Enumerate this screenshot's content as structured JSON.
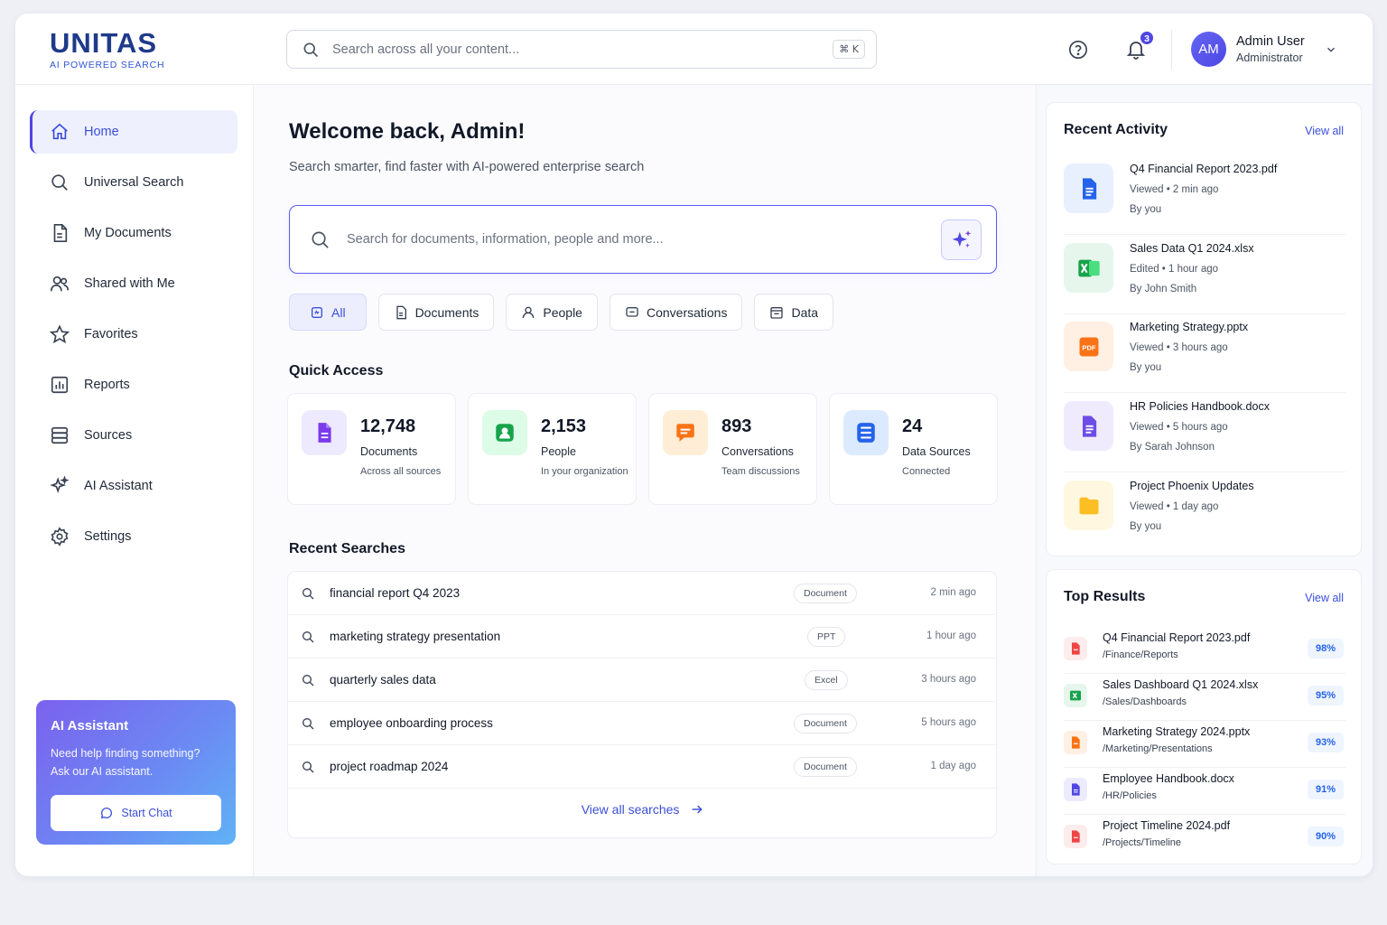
{
  "brand": {
    "name": "UNITAS",
    "tagline": "AI POWERED SEARCH"
  },
  "topbar": {
    "search_placeholder": "Search across all your content...",
    "shortcut": "⌘ K",
    "notification_count": "3",
    "user": {
      "initials": "AM",
      "name": "Admin User",
      "role": "Administrator"
    }
  },
  "sidebar": {
    "items": [
      {
        "label": "Home",
        "icon": "home-icon",
        "active": true
      },
      {
        "label": "Universal Search",
        "icon": "search-icon"
      },
      {
        "label": "My Documents",
        "icon": "document-icon"
      },
      {
        "label": "Shared with Me",
        "icon": "users-icon"
      },
      {
        "label": "Favorites",
        "icon": "star-icon"
      },
      {
        "label": "Reports",
        "icon": "bar-chart-icon"
      },
      {
        "label": "Sources",
        "icon": "database-icon"
      },
      {
        "label": "AI Assistant",
        "icon": "sparkle-icon"
      },
      {
        "label": "Settings",
        "icon": "gear-icon"
      }
    ],
    "ai_card": {
      "title": "AI Assistant",
      "description": "Need help finding something? Ask our AI assistant.",
      "button": "Start Chat"
    }
  },
  "main": {
    "welcome": "Welcome back, Admin!",
    "subtitle": "Search smarter, find faster with AI-powered enterprise search",
    "search_placeholder": "Search for documents, information, people and more...",
    "filters": [
      "All",
      "Documents",
      "People",
      "Conversations",
      "Data"
    ],
    "quick_access_title": "Quick Access",
    "quick_access": [
      {
        "value": "12,748",
        "label": "Documents",
        "sub": "Across all sources",
        "color": "#7c3aed"
      },
      {
        "value": "2,153",
        "label": "People",
        "sub": "In your organization",
        "color": "#16a34a"
      },
      {
        "value": "893",
        "label": "Conversations",
        "sub": "Team discussions",
        "color": "#f97316"
      },
      {
        "value": "24",
        "label": "Data Sources",
        "sub": "Connected",
        "color": "#2563eb"
      }
    ],
    "recent_searches_title": "Recent Searches",
    "recent_searches": [
      {
        "query": "financial report Q4 2023",
        "type": "Document",
        "time": "2 min ago"
      },
      {
        "query": "marketing strategy presentation",
        "type": "PPT",
        "time": "1 hour ago"
      },
      {
        "query": "quarterly sales data",
        "type": "Excel",
        "time": "3 hours ago"
      },
      {
        "query": "employee onboarding process",
        "type": "Document",
        "time": "5 hours ago"
      },
      {
        "query": "project roadmap 2024",
        "type": "Document",
        "time": "1 day ago"
      }
    ],
    "view_all_searches": "View all searches"
  },
  "recent_activity": {
    "title": "Recent Activity",
    "view_all": "View all",
    "items": [
      {
        "name": "Q4 Financial Report 2023.pdf",
        "meta": "Viewed • 2 min ago",
        "by": "By you",
        "icon": "document-icon"
      },
      {
        "name": "Sales Data Q1 2024.xlsx",
        "meta": "Edited • 1 hour ago",
        "by": "By John Smith",
        "icon": "excel-icon"
      },
      {
        "name": "Marketing Strategy.pptx",
        "meta": "Viewed • 3 hours ago",
        "by": "By you",
        "icon": "pdf-icon",
        "badge": "PDF"
      },
      {
        "name": "HR Policies Handbook.docx",
        "meta": "Viewed • 5 hours ago",
        "by": "By Sarah Johnson",
        "icon": "document-icon"
      },
      {
        "name": "Project Phoenix Updates",
        "meta": "Viewed • 1 day ago",
        "by": "By you",
        "icon": "folder-icon"
      }
    ]
  },
  "top_results": {
    "title": "Top Results",
    "view_all": "View all",
    "items": [
      {
        "name": "Q4 Financial Report 2023.pdf",
        "path": "/Finance/Reports",
        "score": "98%",
        "icon": "pdf-icon"
      },
      {
        "name": "Sales Dashboard Q1 2024.xlsx",
        "path": "/Sales/Dashboards",
        "score": "95%",
        "icon": "excel-icon"
      },
      {
        "name": "Marketing Strategy 2024.pptx",
        "path": "/Marketing/Presentations",
        "score": "93%",
        "icon": "ppt-icon"
      },
      {
        "name": "Employee Handbook.docx",
        "path": "/HR/Policies",
        "score": "91%",
        "icon": "doc-icon"
      },
      {
        "name": "Project Timeline 2024.pdf",
        "path": "/Projects/Timeline",
        "score": "90%",
        "icon": "pdf-icon"
      }
    ]
  }
}
